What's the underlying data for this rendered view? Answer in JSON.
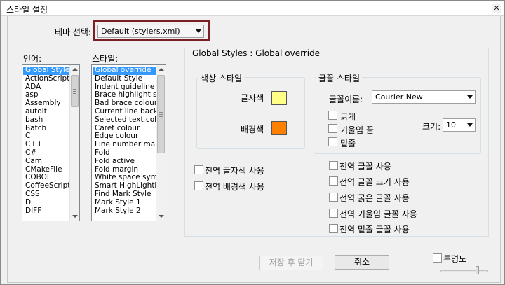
{
  "window": {
    "title": "스타일 설정",
    "close_glyph": "✕"
  },
  "theme": {
    "label": "테마 선택:",
    "selected": "Default (stylers.xml)"
  },
  "languages": {
    "title": "언어:",
    "items": [
      "Global Styles",
      "ActionScript",
      "ADA",
      "asp",
      "Assembly",
      "autoIt",
      "bash",
      "Batch",
      "C",
      "C++",
      "C#",
      "Caml",
      "CMakeFile",
      "COBOL",
      "CoffeeScript",
      "CSS",
      "D",
      "DIFF"
    ],
    "selected_index": 0
  },
  "styles": {
    "title": "스타일:",
    "items": [
      "Global override",
      "Default Style",
      "Indent guideline sty",
      "Brace highlight style",
      "Bad brace colour",
      "Current line backgr",
      "Selected text colou",
      "Caret colour",
      "Edge colour",
      "Line number margin",
      "Fold",
      "Fold active",
      "Fold margin",
      "White space symbo",
      "Smart HighLighting",
      "Find Mark Style",
      "Mark Style 1",
      "Mark Style 2"
    ],
    "selected_index": 0
  },
  "panel": {
    "heading": "Global Styles : Global override"
  },
  "color_style": {
    "group_label": "색상 스타일",
    "fg_label": "글자색",
    "bg_label": "배경색",
    "fg_color": "#ffff88",
    "bg_color": "#ff8000"
  },
  "font_style": {
    "group_label": "글꼴 스타일",
    "name_label": "글꼴이름:",
    "name_value": "Courier New",
    "bold_label": "굵게",
    "italic_label": "기울임 꼴",
    "underline_label": "밑줄",
    "size_label": "크기:",
    "size_value": "10"
  },
  "global_checks": {
    "fg": "전역 글자색 사용",
    "bg": "전역 배경색 사용",
    "font": "전역 글꼴 사용",
    "font_size": "전역 글꼴 크기 사용",
    "bold": "전역 굵은 글꼴 사용",
    "italic": "전역 기울임 글꼴 사용",
    "underline": "전역 밑줄 글꼴 사용"
  },
  "buttons": {
    "save_close": "저장 후 닫기",
    "cancel": "취소"
  },
  "transparency": {
    "label": "투명도"
  }
}
